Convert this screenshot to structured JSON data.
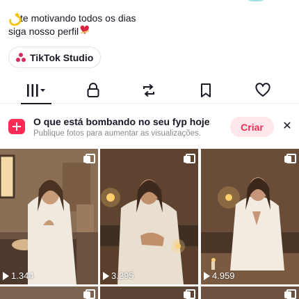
{
  "profile": {
    "bio_line1": "te motivando todos os dias",
    "bio_line2": "siga nosso perfil",
    "bio_emoji1": "dizzy-icon",
    "bio_emoji2": "heart-ribbon-icon",
    "studio_button": "TikTok Studio"
  },
  "tabs": [
    {
      "name": "videos",
      "icon": "grid-icon",
      "active": true
    },
    {
      "name": "private",
      "icon": "lock-icon",
      "active": false
    },
    {
      "name": "reposts",
      "icon": "repost-icon",
      "active": false
    },
    {
      "name": "favorites",
      "icon": "bookmark-icon",
      "active": false
    },
    {
      "name": "liked",
      "icon": "heart-icon",
      "active": false
    }
  ],
  "fyp_banner": {
    "title": "O que está bombando no seu fyp hoje",
    "subtitle": "Publique fotos para aumentar as visualizações.",
    "create_label": "Criar",
    "close_label": "✕"
  },
  "videos": [
    {
      "views": "1.344",
      "multi": true
    },
    {
      "views": "3.295",
      "multi": true
    },
    {
      "views": "4.959",
      "multi": true
    },
    {
      "views": "",
      "multi": true
    },
    {
      "views": "",
      "multi": true
    },
    {
      "views": "",
      "multi": true
    }
  ],
  "colors": {
    "accent": "#fe2c55",
    "accent_soft": "#ffe6ea",
    "text": "#161823",
    "muted": "#8a8b91"
  }
}
